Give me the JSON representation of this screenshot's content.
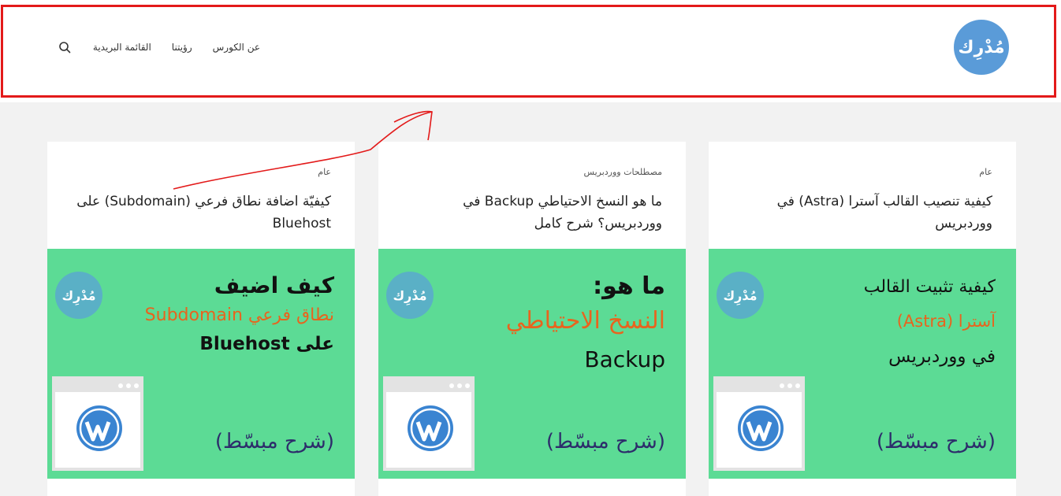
{
  "header": {
    "logo_text": "مُدْرِك",
    "nav": [
      "عن الكورس",
      "رؤيتنا",
      "القائمة البريدية"
    ],
    "search_icon": "search-icon"
  },
  "cards": [
    {
      "category": "عام",
      "title": "كيفية تنصيب القالب آسترا (Astra) في ووردبريس",
      "thumb": {
        "logo": "مُدْرِك",
        "line1": "كيفية تثبيت القالب",
        "line2": "آسترا (Astra)",
        "line3": "في ووردبريس",
        "bottom": "(شرح مبسّط)"
      }
    },
    {
      "category": "مصطلحات ووردبريس",
      "title": "ما هو النسخ الاحتياطي Backup في ووردبريس؟ شرح كامل",
      "thumb": {
        "logo": "مُدْرِك",
        "line1": "ما هو:",
        "line2": "النسخ الاحتياطي",
        "line3": "Backup",
        "bottom": "(شرح مبسّط)"
      }
    },
    {
      "category": "عام",
      "title": "كيفيّة اضافة نطاق فرعي (Subdomain) على Bluehost",
      "thumb": {
        "logo": "مُدْرِك",
        "line1": "كيف اضيف",
        "line2": "نطاق فرعي Subdomain",
        "line3": "على Bluehost",
        "bottom": "(شرح مبسّط)"
      }
    }
  ],
  "colors": {
    "accent": "#5a9bd8",
    "thumb_bg": "#5cdb95",
    "orange": "#e8641e",
    "annotation": "#e31a1a"
  }
}
